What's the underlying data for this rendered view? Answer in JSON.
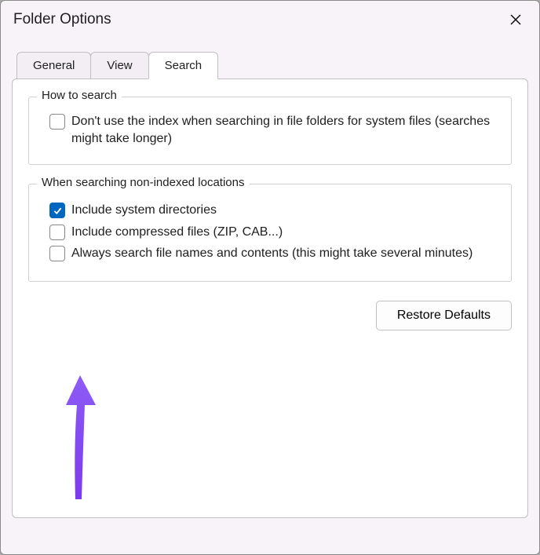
{
  "window": {
    "title": "Folder Options"
  },
  "tabs": {
    "general": "General",
    "view": "View",
    "search": "Search"
  },
  "group1": {
    "legend": "How to search",
    "opt_noindex": "Don't use the index when searching in file folders for system files (searches might take longer)"
  },
  "group2": {
    "legend": "When searching non-indexed locations",
    "opt_sysdirs": "Include system directories",
    "opt_compressed": "Include compressed files (ZIP, CAB...)",
    "opt_contents": "Always search file names and contents (this might take several minutes)"
  },
  "buttons": {
    "restore": "Restore Defaults"
  }
}
